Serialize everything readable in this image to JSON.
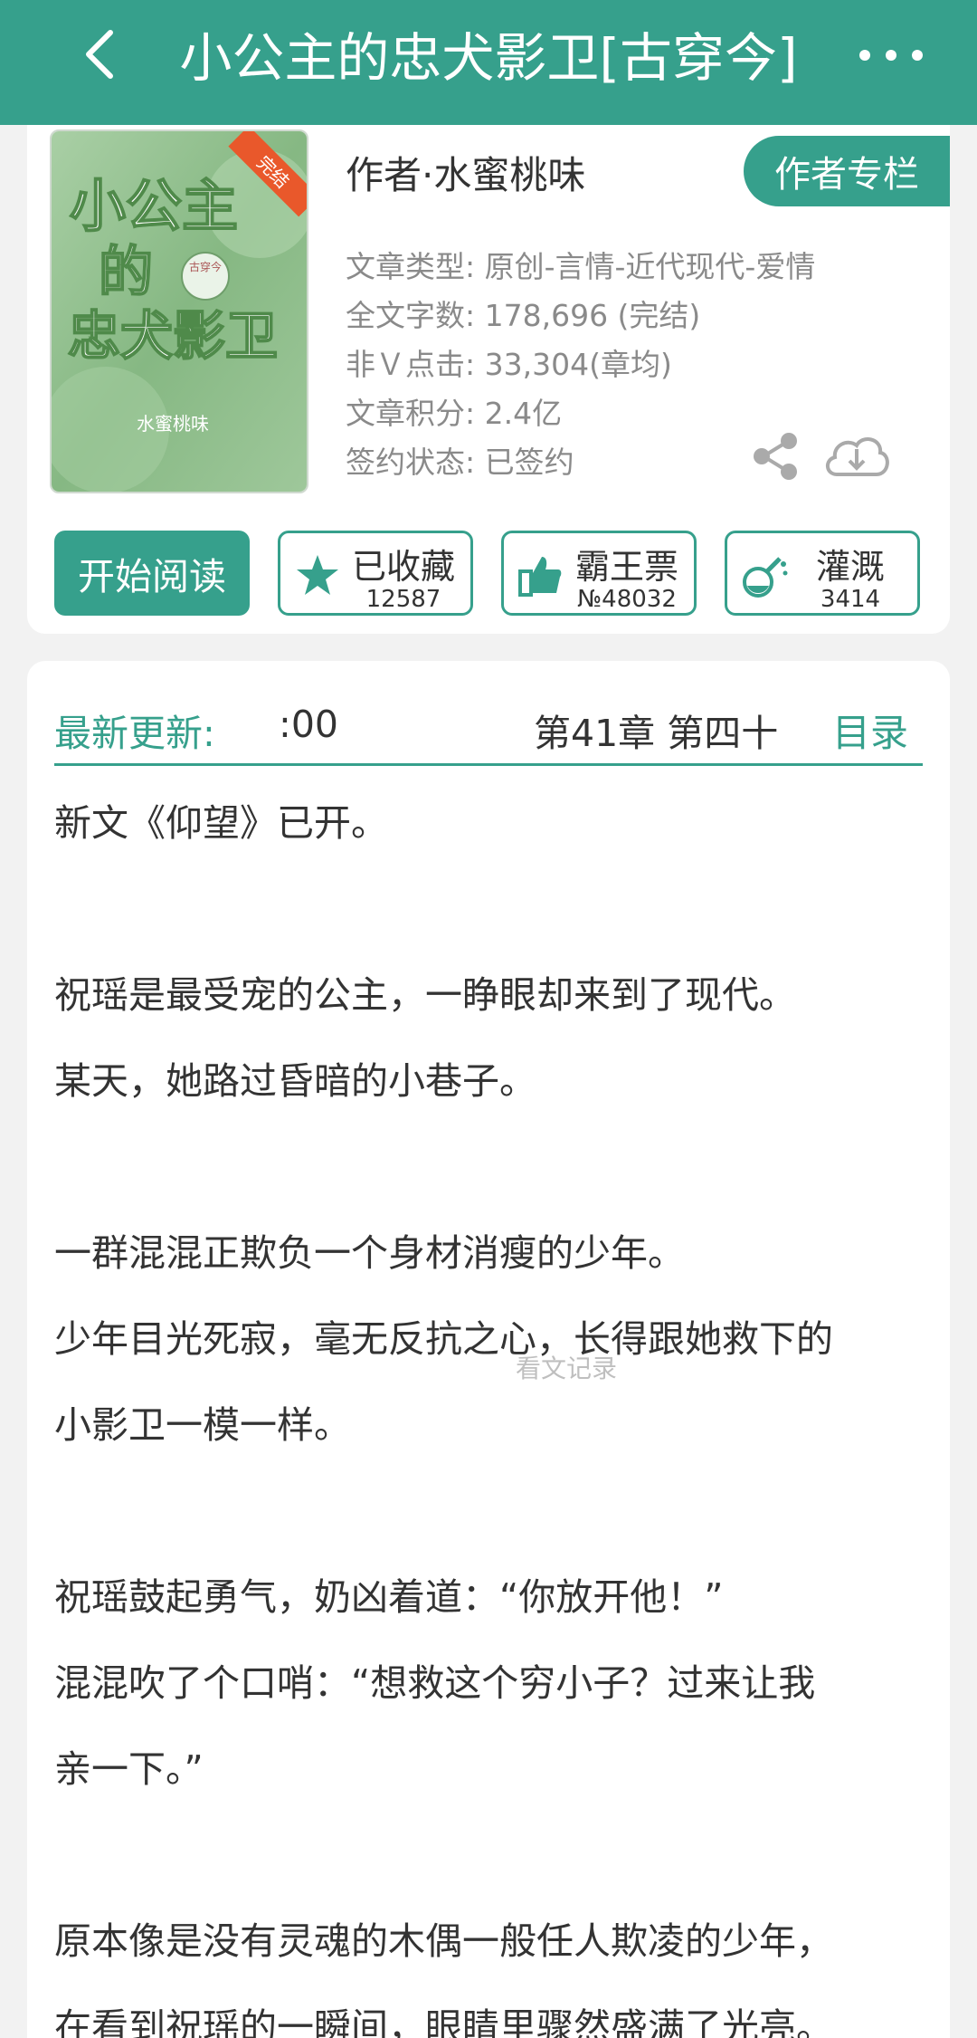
{
  "header": {
    "title": "小公主的忠犬影卫[古穿今]"
  },
  "book": {
    "cover": {
      "title_line1": "小公主",
      "title_line2": "的",
      "title_line3": "忠犬影卫",
      "badge": "完结",
      "tag": "古穿今",
      "author_sig": "水蜜桃味"
    },
    "author": "作者·水蜜桃味",
    "author_button": "作者专栏",
    "meta": [
      "文章类型: 原创-言情-近代现代-爱情",
      "全文字数: 178,696 (完结)",
      "非Ｖ点击: 33,304(章均)",
      "文章积分: 2.4亿",
      "签约状态:  已签约"
    ],
    "read_button": "开始阅读",
    "stats": [
      {
        "label": "已收藏",
        "value": "12587",
        "icon": "star-icon"
      },
      {
        "label": "霸王票",
        "value": "№48032",
        "icon": "thumbs-up-icon"
      },
      {
        "label": "灌溉",
        "value": "3414",
        "icon": "flask-icon"
      }
    ]
  },
  "update": {
    "label": "最新更新:",
    "time": ":00",
    "chapter": "第41章  第四十",
    "catalog": "目录"
  },
  "intro": [
    "新文《仰望》已开。",
    "",
    "祝瑶是最受宠的公主，一睁眼却来到了现代。",
    "某天，她路过昏暗的小巷子。",
    "",
    "一群混混正欺负一个身材消瘦的少年。",
    "少年目光死寂，毫无反抗之心，长得跟她救下的",
    "小影卫一模一样。",
    "",
    "祝瑶鼓起勇气，奶凶着道：“你放开他！”",
    "混混吹了个口哨：“想救这个穷小子？过来让我",
    "亲一下。”",
    "",
    "原本像是没有灵魂的木偶一般任人欺凌的少年，",
    "在看到祝瑶的一瞬间，眼睛里骤然盛满了光亮。"
  ],
  "watermark": "看文记录",
  "colors": {
    "accent": "#36a08c",
    "badge": "#e9582b",
    "cover_bg": "#93bf90"
  }
}
